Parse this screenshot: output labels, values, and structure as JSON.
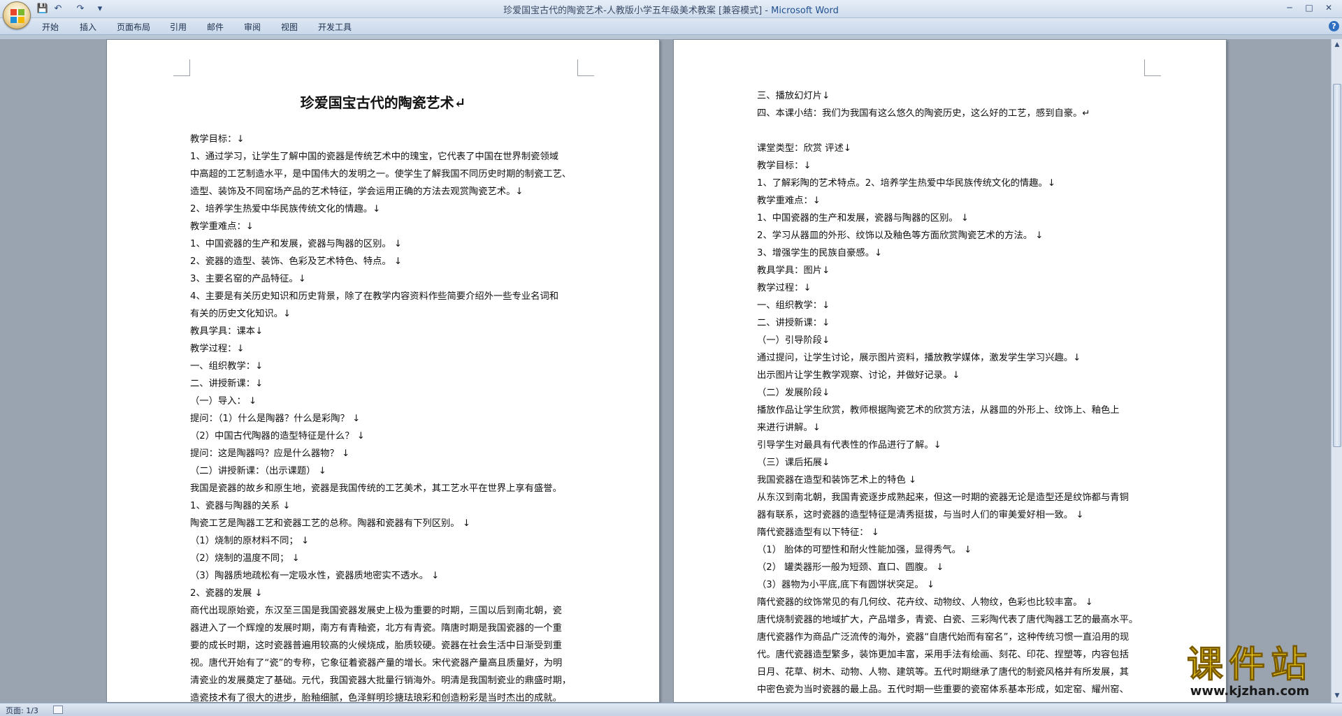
{
  "window": {
    "title_doc": "珍爱国宝古代的陶瓷艺术-人教版小学五年级美术教案 [兼容模式] - ",
    "title_app": "Microsoft Word",
    "minimize": "─",
    "maximize": "□",
    "close": "✕"
  },
  "quick_access": {
    "save": "💾",
    "undo": "↶",
    "redo": "↷",
    "customize": "▾"
  },
  "ribbon_tabs": [
    "开始",
    "插入",
    "页面布局",
    "引用",
    "邮件",
    "审阅",
    "视图",
    "开发工具"
  ],
  "help": "?",
  "page1": {
    "heading": "珍爱国宝古代的陶瓷艺术↵",
    "lines": [
      "教学目标：↓",
      "1、通过学习，让学生了解中国的瓷器是传统艺术中的瑰宝，它代表了中国在世界制瓷领域",
      "中高超的工艺制造水平，是中国伟大的发明之一。使学生了解我国不同历史时期的制瓷工艺、",
      "造型、装饰及不同窑场产品的艺术特征，学会运用正确的方法去观赏陶瓷艺术。↓",
      "2、培养学生热爱中华民族传统文化的情趣。↓",
      "教学重难点：↓",
      "1、中国瓷器的生产和发展，瓷器与陶器的区别。 ↓",
      "2、瓷器的造型、装饰、色彩及艺术特色、特点。 ↓",
      "3、主要名窑的产品特征。↓",
      "4、主要是有关历史知识和历史背景，除了在教学内容资料作些简要介绍外一些专业名词和",
      "有关的历史文化知识。↓",
      "教具学具：课本↓",
      "教学过程：↓",
      "一、组织教学：↓",
      "二、讲授新课：↓",
      "（一）导入： ↓",
      "提问：（1）什么是陶器？什么是彩陶？ ↓",
      "（2）中国古代陶器的造型特征是什么？ ↓",
      "提问：这是陶器吗？应是什么器物？ ↓",
      "（二）讲授新课：（出示课题） ↓",
      "我国是瓷器的故乡和原生地，瓷器是我国传统的工艺美术，其工艺水平在世界上享有盛誉。",
      "1、瓷器与陶器的关系 ↓",
      "陶瓷工艺是陶器工艺和瓷器工艺的总称。陶器和瓷器有下列区别。 ↓",
      "（1）烧制的原材料不同； ↓",
      "（2）烧制的温度不同； ↓",
      "（3）陶器质地疏松有一定吸水性，瓷器质地密实不透水。 ↓",
      "2、瓷器的发展 ↓",
      "商代出现原始瓷，东汉至三国是我国瓷器发展史上极为重要的时期，三国以后到南北朝，瓷",
      "器进入了一个辉煌的发展时期，南方有青釉瓷，北方有青瓷。隋唐时期是我国瓷器的一个重",
      "要的成长时期，这时瓷器普遍用较高的火候烧成，胎质较硬。瓷器在社会生活中日渐受到重",
      "视。唐代开始有了“瓷”的专称，它象征着瓷器产量的增长。宋代瓷器产量高且质量好，为明",
      "清瓷业的发展奠定了基础。元代，我国瓷器大批量行销海外。明清是我国制瓷业的鼎盛时期，",
      "造瓷技术有了很大的进步，胎釉细腻，色泽鲜明珍搪珐琅彩和创造粉彩是当时杰出的成就。"
    ]
  },
  "page2": {
    "lines": [
      "三、播放幻灯片↓",
      "四、本课小结：我们为我国有这么悠久的陶瓷历史，这么好的工艺，感到自豪。↵",
      "",
      "课堂类型：欣赏  评述↓",
      "教学目标：↓",
      "1、了解彩陶的艺术特点。2、培养学生热爱中华民族传统文化的情趣。↓",
      "教学重难点：↓",
      "1、中国瓷器的生产和发展，瓷器与陶器的区别。 ↓",
      "2、学习从器皿的外形、纹饰以及釉色等方面欣赏陶瓷艺术的方法。 ↓",
      "3、增强学生的民族自豪感。↓",
      "教具学具：图片↓",
      "教学过程：↓",
      "一、组织教学：↓",
      "二、讲授新课：↓",
      "（一）引导阶段↓",
      " 通过提问，让学生讨论，展示图片资料，播放教学媒体，激发学生学习兴趣。↓",
      "出示图片让学生教学观察、讨论，并做好记录。↓",
      "（二）发展阶段↓",
      " 播放作品让学生欣赏，教师根据陶瓷艺术的欣赏方法，从器皿的外形上、纹饰上、釉色上",
      "来进行讲解。↓",
      "引导学生对最具有代表性的作品进行了解。↓",
      "（三）课后拓展↓",
      "我国瓷器在造型和装饰艺术上的特色 ↓",
      "从东汉到南北朝，我国青瓷逐步成熟起来，但这一时期的瓷器无论是造型还是纹饰都与青铜",
      "器有联系，这时瓷器的造型特征是清秀挺拔，与当时人们的审美爱好相一致。 ↓",
      "隋代瓷器造型有以下特征： ↓",
      "（1） 胎体的可塑性和耐火性能加强，显得秀气。 ↓",
      "（2） 罐类器形一般为短颈、直口、圆腹。 ↓",
      "（3）器物为小平底,底下有圆饼状突足。 ↓",
      "隋代瓷器的纹饰常见的有几何纹、花卉纹、动物纹、人物纹，色彩也比较丰富。 ↓",
      "唐代烧制瓷器的地域扩大，产品增多，青瓷、白瓷、三彩陶代表了唐代陶器工艺的最高水平。",
      "唐代瓷器作为商品广泛流传的海外，瓷器“自唐代始而有窑名”，这种传统习惯一直沿用的现",
      "代。唐代瓷器造型繁多，装饰更加丰富，采用手法有绘画、刻花、印花、捏塑等，内容包括",
      "日月、花草、树木、动物、人物、建筑等。五代时期继承了唐代的制瓷风格并有所发展，其",
      "中密色瓷为当时瓷器的最上品。五代时期一些重要的瓷窑体系基本形成，如定窑、耀州窑、"
    ]
  },
  "statusbar": {
    "page": "页面: 1/3"
  },
  "watermark": {
    "main": "课件站",
    "sub": "www.kjzhan.com"
  }
}
